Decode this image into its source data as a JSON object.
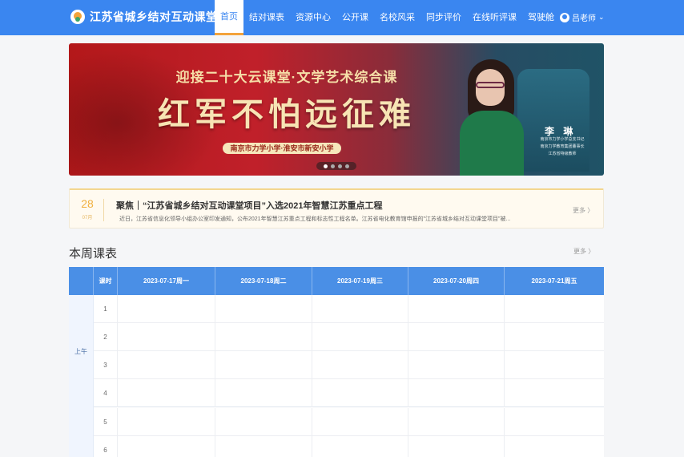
{
  "app": {
    "title": "江苏省城乡结对互动课堂"
  },
  "nav": {
    "items": [
      {
        "label": "首页",
        "active": true
      },
      {
        "label": "结对课表",
        "active": false
      },
      {
        "label": "资源中心",
        "active": false
      },
      {
        "label": "公开课",
        "active": false
      },
      {
        "label": "名校风采",
        "active": false
      },
      {
        "label": "同步评价",
        "active": false
      },
      {
        "label": "在线听评课",
        "active": false
      },
      {
        "label": "驾驶舱",
        "active": false
      }
    ]
  },
  "user": {
    "name": "吕老师"
  },
  "banner": {
    "subtitle": "迎接二十大云课堂·文学艺术综合课",
    "headline": "红军不怕远征难",
    "schools": "南京市力学小学·淮安市新安小学",
    "teacher_name": "李 琳",
    "teacher_desc": [
      "南京市力学小学总支书记",
      "南京力学教育集团董事长",
      "江苏省特级教师"
    ],
    "slides": 4,
    "active_slide": 1
  },
  "news": {
    "day": "28",
    "month": "07月",
    "headline": "聚焦｜“江苏省城乡结对互动课堂项目”入选2021年智慧江苏重点工程",
    "summary": "近日，江苏省信息化领导小组办公室印发通知，公布2021年智慧江苏重点工程和标志性工程名单。江苏省电化教育馆申报的\"江苏省城乡结对互动课堂项目\"被...",
    "more": "更多 〉"
  },
  "schedule": {
    "title": "本周课表",
    "more": "更多 〉",
    "period_header": "",
    "slot_header": "课时",
    "days": [
      "2023-07-17周一",
      "2023-07-18周二",
      "2023-07-19周三",
      "2023-07-20周四",
      "2023-07-21周五"
    ],
    "period_morning": "上午",
    "slots": [
      "1",
      "2",
      "3",
      "4",
      "5",
      "6"
    ]
  },
  "colors": {
    "header": "#3a86f0",
    "accent": "#f3a33b",
    "table_head": "#4a8fe6"
  }
}
